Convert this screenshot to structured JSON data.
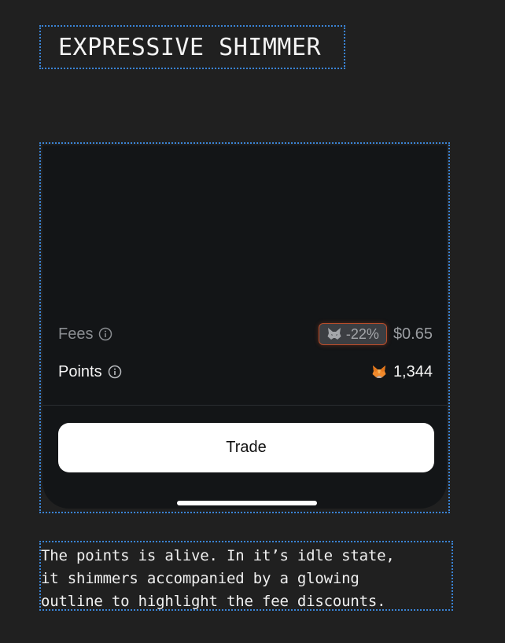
{
  "heading": {
    "title": "EXPRESSIVE SHIMMER"
  },
  "card": {
    "fees": {
      "label": "Fees",
      "info_icon": "info-icon",
      "discount_icon": "metamask-fox-icon",
      "discount": "-22%",
      "value": "$0.65"
    },
    "points": {
      "label": "Points",
      "info_icon": "info-icon",
      "points_icon": "metamask-fox-icon",
      "value": "1,344"
    },
    "trade_button": {
      "label": "Trade"
    }
  },
  "caption": {
    "line1": "The points is alive. In it’s idle state,",
    "line2": "it shimmers accompanied by a glowing",
    "line3": "outline to highlight the fee discounts."
  },
  "colors": {
    "background": "#202020",
    "card": "#131517",
    "badge_outline": "#b84c2a",
    "button": "#ffffff",
    "guide_outline": "#3a84d6"
  }
}
